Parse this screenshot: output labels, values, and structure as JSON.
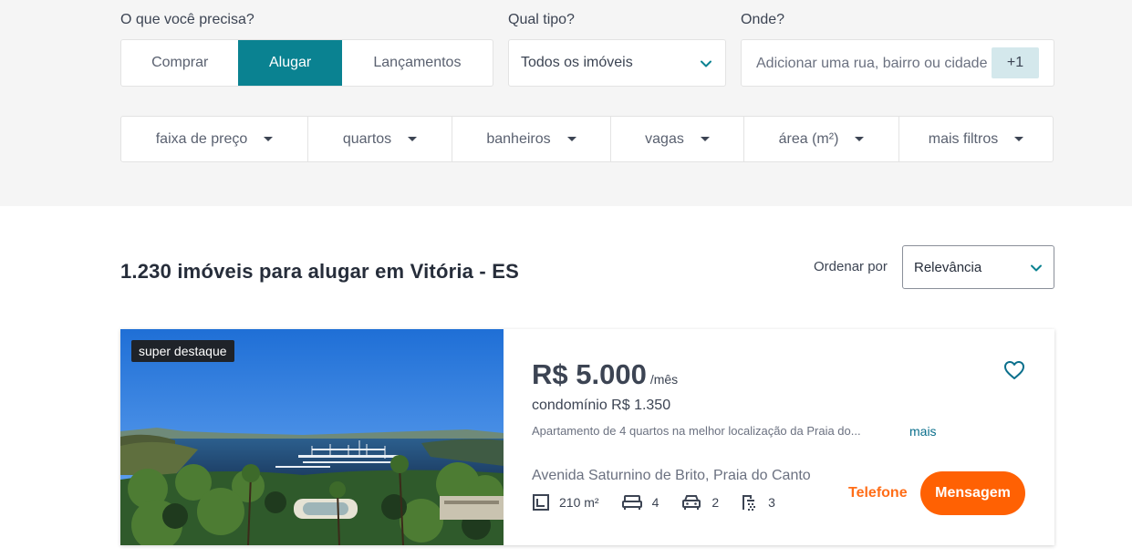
{
  "search": {
    "need_label": "O que você precisa?",
    "modes": [
      {
        "label": "Comprar",
        "active": false
      },
      {
        "label": "Alugar",
        "active": true
      },
      {
        "label": "Lançamentos",
        "active": false
      }
    ],
    "type_label": "Qual tipo?",
    "type_value": "Todos os imóveis",
    "where_label": "Onde?",
    "where_placeholder": "Adicionar uma rua, bairro ou cidade",
    "where_extra": "+1"
  },
  "filters": [
    "faixa de preço",
    "quartos",
    "banheiros",
    "vagas",
    "área (m²)",
    "mais filtros"
  ],
  "results": {
    "title": "1.230 imóveis para alugar em Vitória - ES",
    "sort_label": "Ordenar por",
    "sort_value": "Relevância"
  },
  "listing": {
    "badge": "super destaque",
    "price": "R$ 5.000",
    "period": "/mês",
    "condo": "condomínio R$ 1.350",
    "description": "Apartamento de 4 quartos na melhor localização da Praia do...",
    "more": "mais",
    "address": "Avenida Saturnino de Brito, Praia do Canto",
    "area": "210 m²",
    "bedrooms": "4",
    "parking": "2",
    "bathrooms": "3",
    "phone_label": "Telefone",
    "message_label": "Mensagem"
  },
  "colors": {
    "accent": "#0a8291",
    "cta": "#ff6103",
    "phone_text": "#ff6d17",
    "background": "#f5f5f5"
  },
  "icons": [
    "chevron-down-icon",
    "caret-down-icon",
    "heart-icon",
    "area-icon",
    "bed-icon",
    "car-icon",
    "shower-icon"
  ]
}
